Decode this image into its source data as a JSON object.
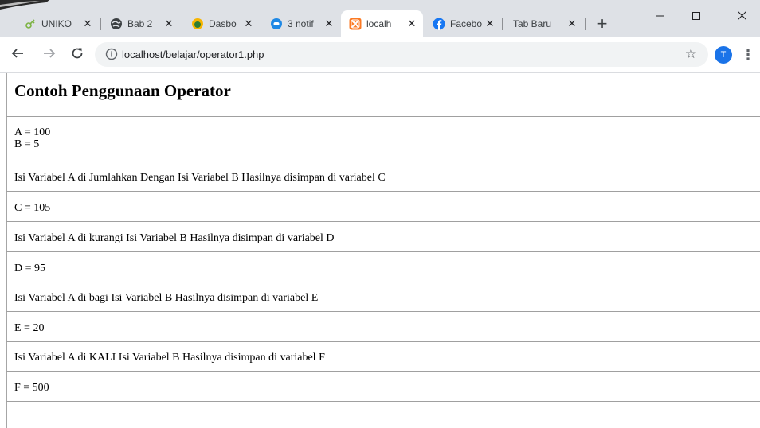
{
  "browser": {
    "tabs": [
      {
        "title": "UNIKO",
        "icon": "key-icon",
        "active": false
      },
      {
        "title": "Bab 2",
        "icon": "globe-icon",
        "active": false
      },
      {
        "title": "Dasbo",
        "icon": "moodle-icon",
        "active": false
      },
      {
        "title": "3 notif",
        "icon": "messenger-icon",
        "active": false
      },
      {
        "title": "localh",
        "icon": "xampp-icon",
        "active": true
      },
      {
        "title": "Facebo",
        "icon": "facebook-icon",
        "active": false
      },
      {
        "title": "Tab Baru",
        "icon": "",
        "active": false
      }
    ],
    "new_tab": "+",
    "window_controls": {
      "minimize": "—",
      "maximize": "☐",
      "close": "✕"
    },
    "url": "localhost/belajar/operator1.php",
    "profile_initial": "T"
  },
  "page": {
    "heading": "Contoh Penggunaan Operator",
    "a_line": "A = 100",
    "b_line": "B = 5",
    "sum_desc": "Isi Variabel A di Jumlahkan Dengan Isi Variabel B Hasilnya disimpan di variabel C",
    "sum_result": "C = 105",
    "sub_desc": "Isi Variabel A di kurangi Isi Variabel B Hasilnya disimpan di variabel D",
    "sub_result": "D = 95",
    "div_desc": "Isi Variabel A di bagi Isi Variabel B Hasilnya disimpan di variabel E",
    "div_result": "E = 20",
    "mul_desc": "Isi Variabel A di KALI Isi Variabel B Hasilnya disimpan di variabel F",
    "mul_result": "F = 500"
  },
  "colors": {
    "chrome_bg": "#dee1e6",
    "omnibox_bg": "#f1f3f4",
    "avatar": "#1a73e8",
    "facebook": "#1877f2",
    "xampp": "#fb7a24"
  }
}
